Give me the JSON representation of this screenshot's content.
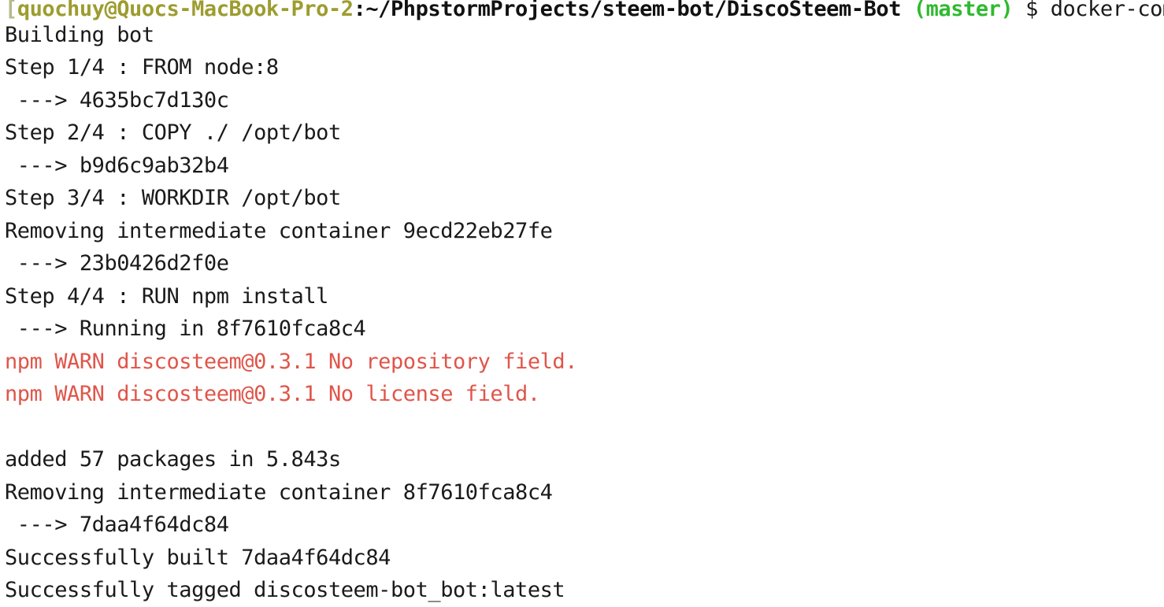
{
  "terminal": {
    "background_color": "#ffffff",
    "default_text_color": "#1a1a1a",
    "prompt": {
      "open_bracket": "[",
      "user_host": "quochuy@Quocs-MacBook-Pro-2",
      "user_host_color": "#9d9c30",
      "path": ":~/PhpstormProjects/steem-bot/DiscoSteem-Bot",
      "path_color": "#111111",
      "branch": "(master)",
      "branch_color": "#2fba2f",
      "sigil": " $ ",
      "command": "docker-compose build",
      "command_color": "#1a1a1a"
    },
    "warn_color": "#e0554a",
    "output_lines": [
      {
        "text": "Building bot",
        "style": "normal"
      },
      {
        "text": "Step 1/4 : FROM node:8",
        "style": "normal"
      },
      {
        "text": " ---> 4635bc7d130c",
        "style": "normal"
      },
      {
        "text": "Step 2/4 : COPY ./ /opt/bot",
        "style": "normal"
      },
      {
        "text": " ---> b9d6c9ab32b4",
        "style": "normal"
      },
      {
        "text": "Step 3/4 : WORKDIR /opt/bot",
        "style": "normal"
      },
      {
        "text": "Removing intermediate container 9ecd22eb27fe",
        "style": "normal"
      },
      {
        "text": " ---> 23b0426d2f0e",
        "style": "normal"
      },
      {
        "text": "Step 4/4 : RUN npm install",
        "style": "normal"
      },
      {
        "text": " ---> Running in 8f7610fca8c4",
        "style": "normal"
      },
      {
        "text": "npm WARN discosteem@0.3.1 No repository field.",
        "style": "warn"
      },
      {
        "text": "npm WARN discosteem@0.3.1 No license field.",
        "style": "warn"
      },
      {
        "text": " ",
        "style": "blank"
      },
      {
        "text": "added 57 packages in 5.843s",
        "style": "normal"
      },
      {
        "text": "Removing intermediate container 8f7610fca8c4",
        "style": "normal"
      },
      {
        "text": " ---> 7daa4f64dc84",
        "style": "normal"
      },
      {
        "text": "Successfully built 7daa4f64dc84",
        "style": "normal"
      },
      {
        "text": "Successfully tagged discosteem-bot_bot:latest",
        "style": "normal"
      }
    ]
  }
}
